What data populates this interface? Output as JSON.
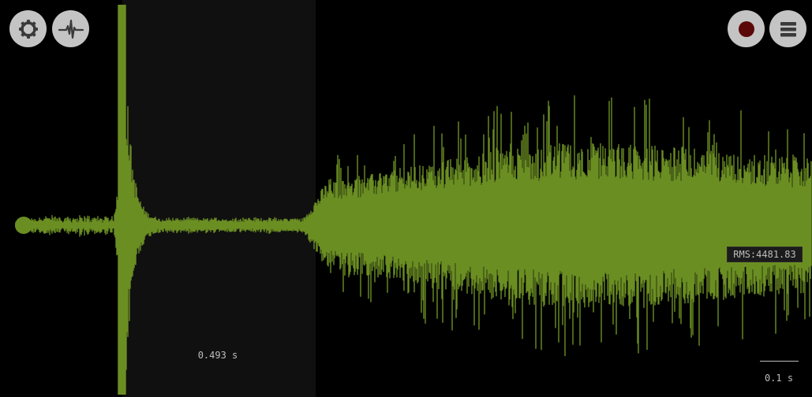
{
  "colors": {
    "background": "#000000",
    "selection": "#101010",
    "waveform": "#6b8e23",
    "button_fill": "#c4c4c4",
    "button_icon": "#3a3a3a",
    "record_dot": "#5a0808",
    "text": "#bdbdbd"
  },
  "toolbar_left": {
    "settings_icon": "gear-icon",
    "waveform_icon": "pulse-icon"
  },
  "toolbar_right": {
    "record_icon": "record-icon",
    "menu_icon": "hamburger-menu-icon"
  },
  "selection": {
    "duration_label": "0.493 s"
  },
  "rms": {
    "label": "RMS:4481.83"
  },
  "time_scale": {
    "label": "0.1 s"
  }
}
